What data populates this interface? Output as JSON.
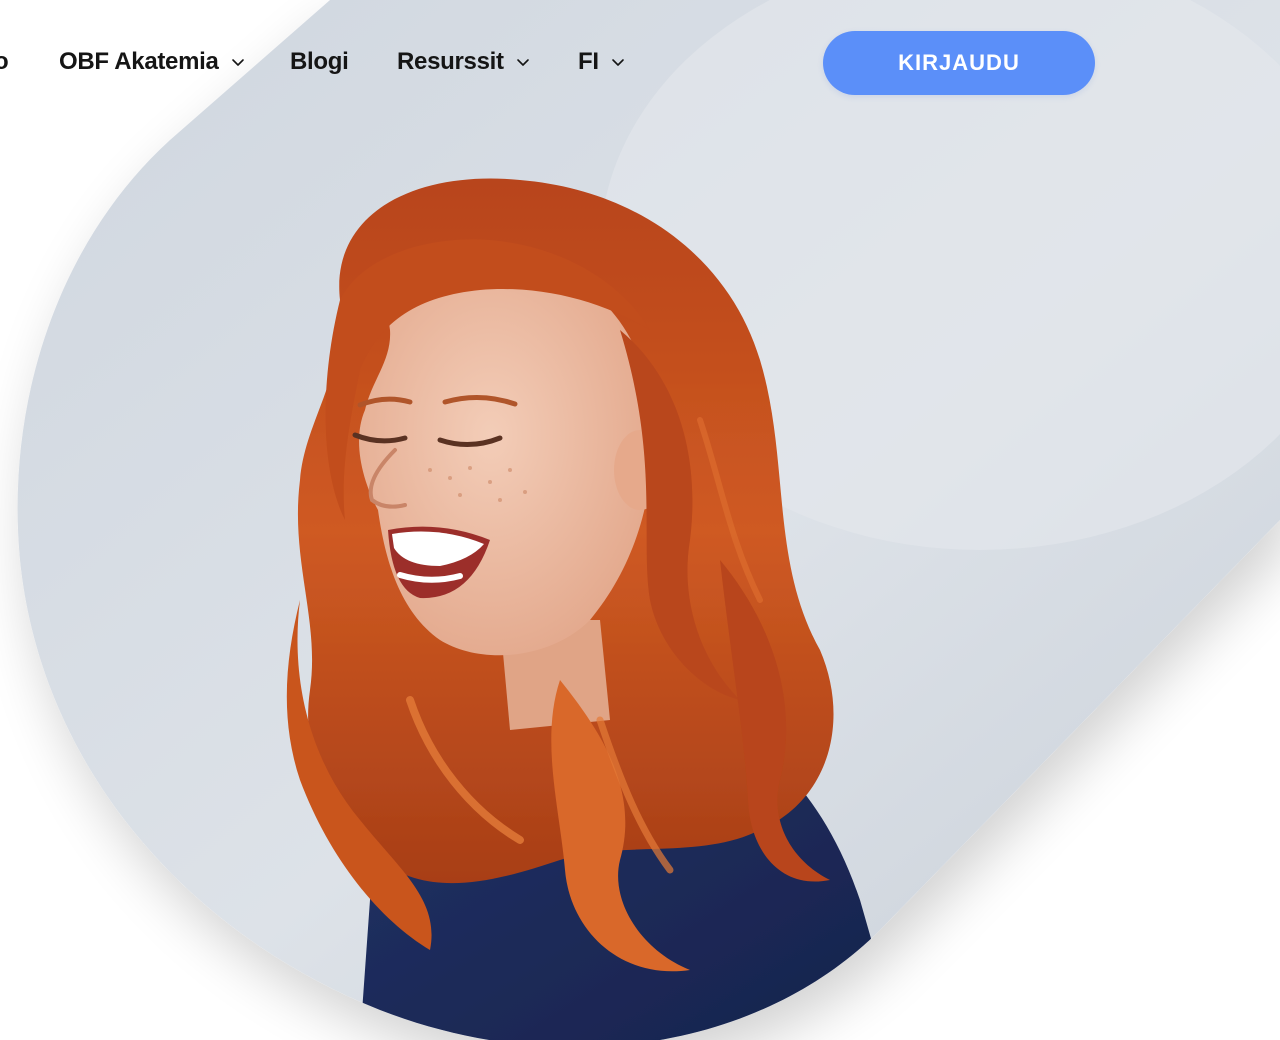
{
  "nav": {
    "partial_item_label": "o",
    "items": [
      {
        "label": "OBF Akatemia",
        "has_dropdown": true
      },
      {
        "label": "Blogi",
        "has_dropdown": false
      },
      {
        "label": "Resurssit",
        "has_dropdown": true
      },
      {
        "label": "FI",
        "has_dropdown": true
      }
    ],
    "login_label": "KIRJAUDU"
  },
  "colors": {
    "accent": "#5b8ff9",
    "nav_text": "#151515",
    "backdrop": "#d6dce4",
    "hair": "#c6501e",
    "sweater": "#1c2a5c"
  },
  "icons": {
    "dropdown": "chevron-down-icon"
  }
}
